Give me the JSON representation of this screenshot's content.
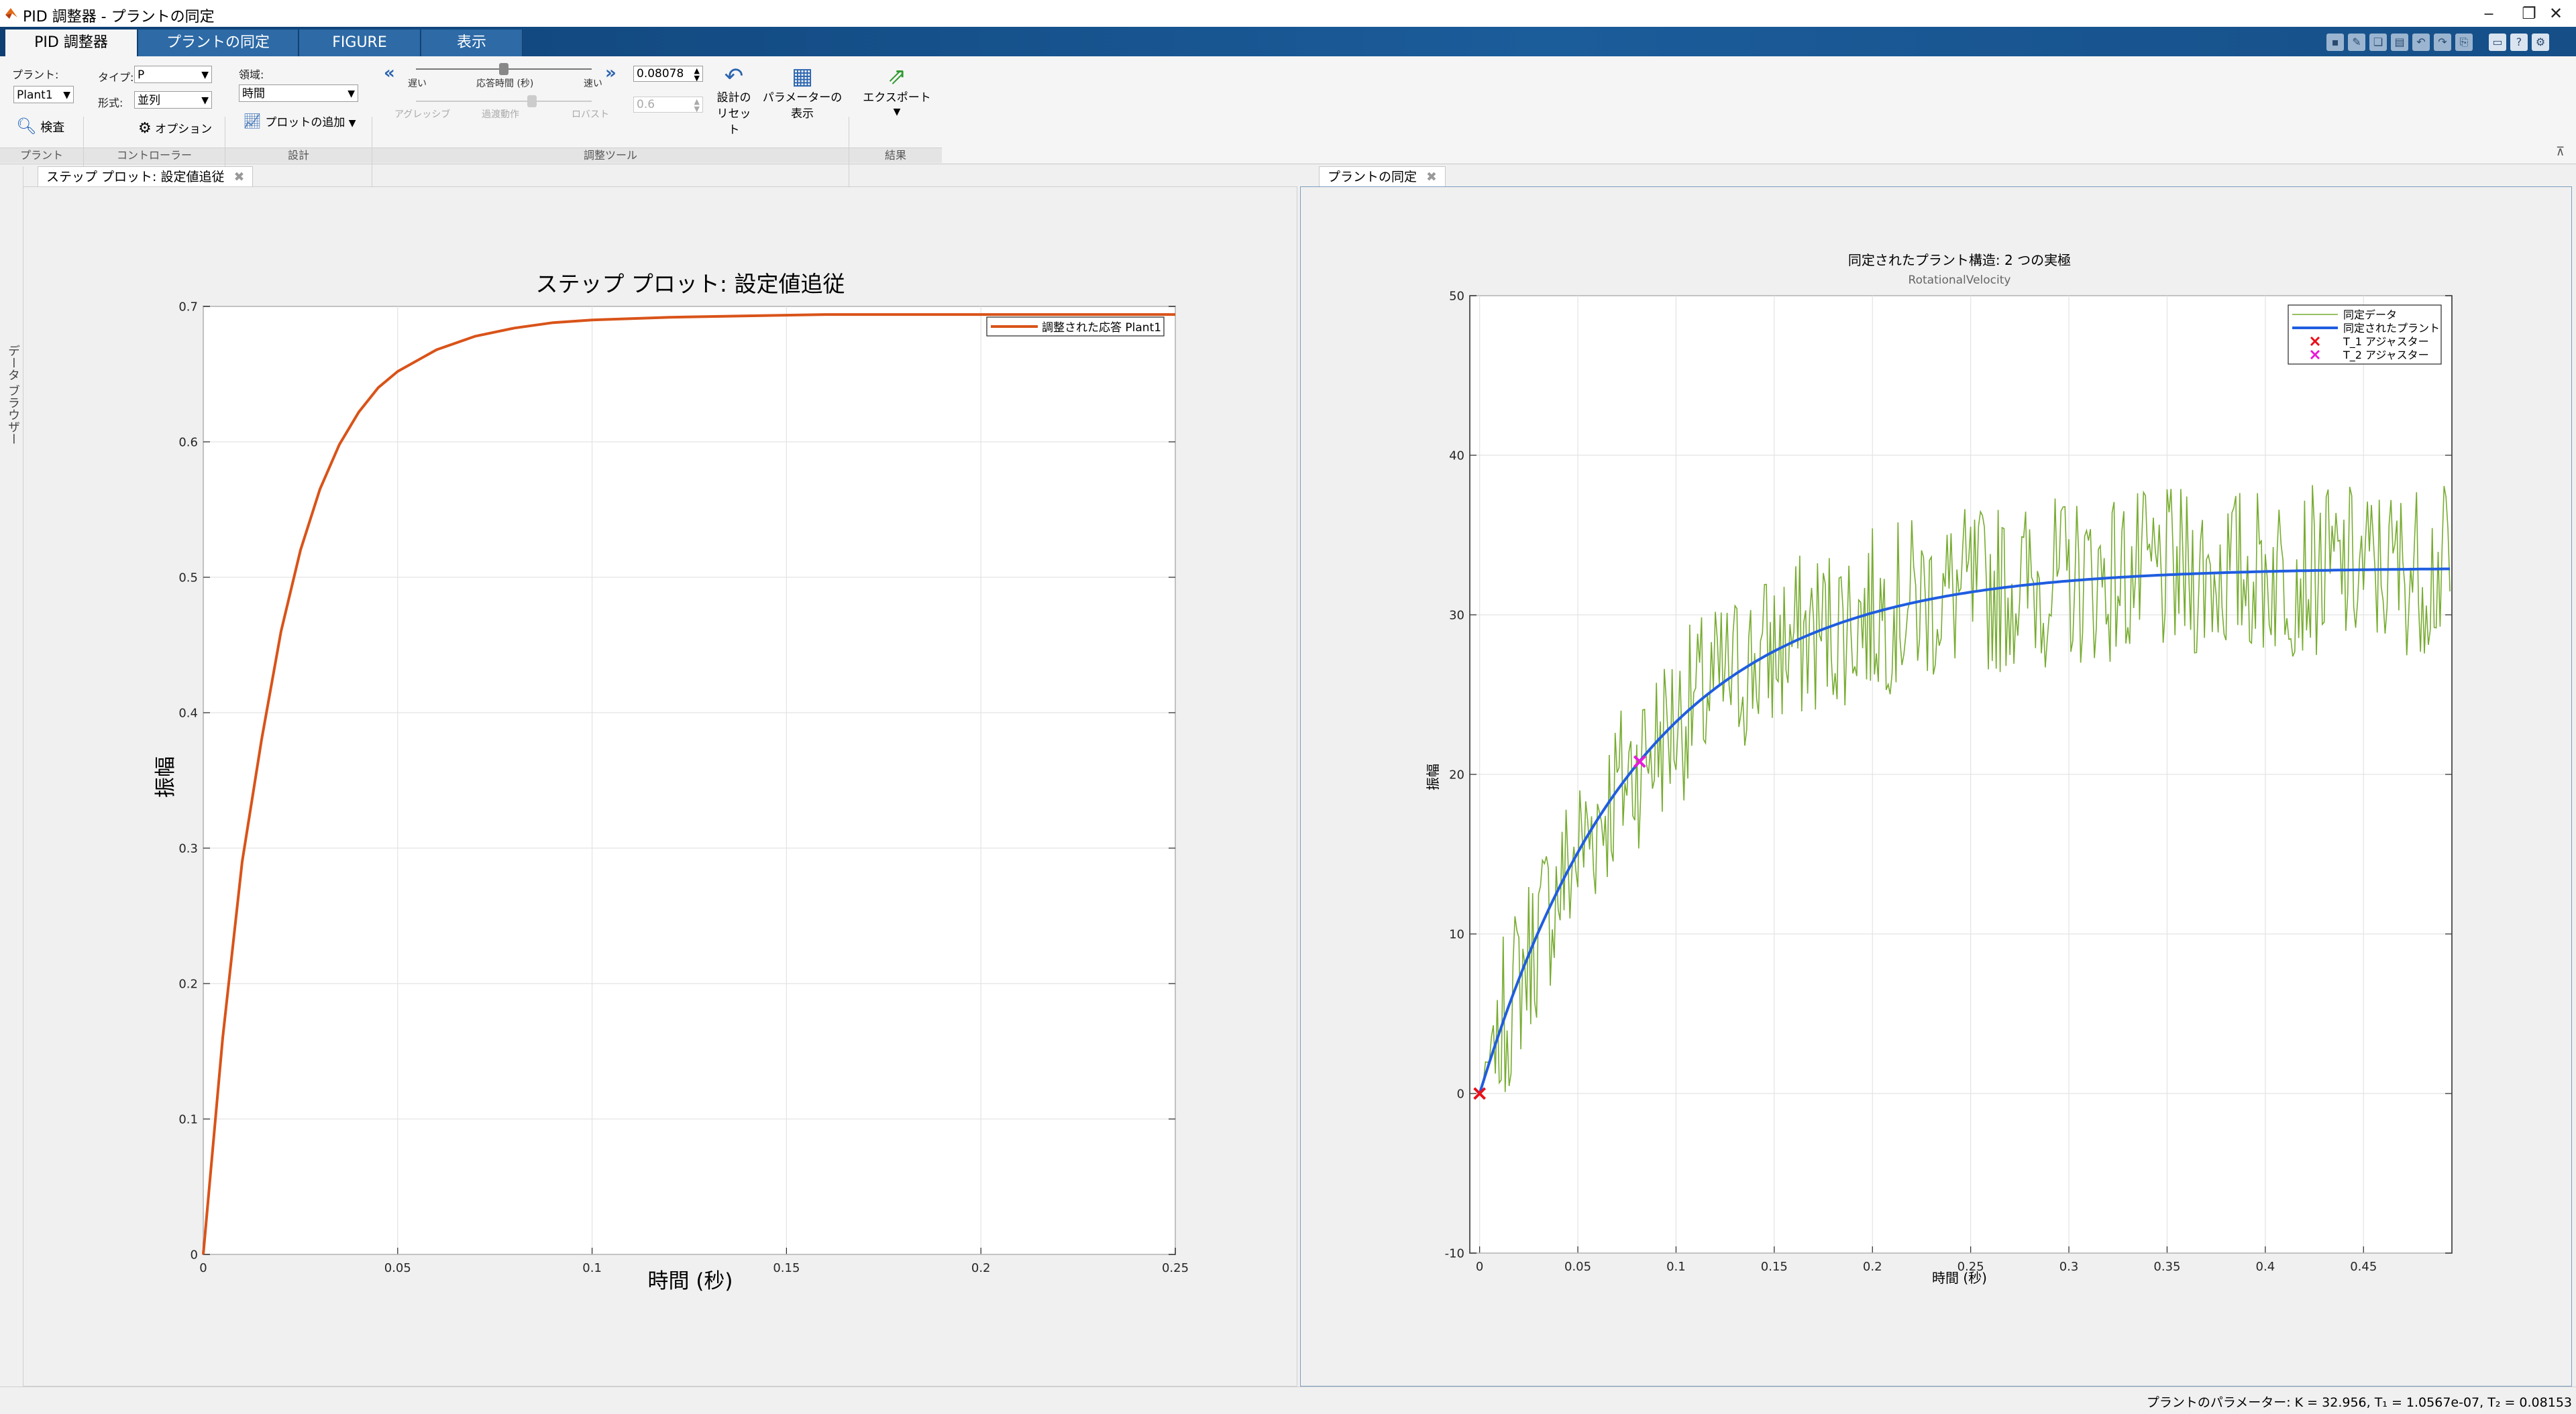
{
  "window": {
    "title": "PID 調整器 - プラントの同定",
    "buttons": [
      "‒",
      "❐",
      "✕"
    ]
  },
  "ribbon_tabs": [
    {
      "label": "PID 調整器",
      "active": true
    },
    {
      "label": "プラントの同定",
      "active": false
    },
    {
      "label": "FIGURE",
      "active": false
    },
    {
      "label": "表示",
      "active": false
    }
  ],
  "ribbon": {
    "plant": {
      "label": "プラント:",
      "value": "Plant1",
      "inspect": "検査",
      "section": "プラント"
    },
    "controller": {
      "type_label": "タイプ:",
      "type_value": "P",
      "form_label": "形式:",
      "form_value": "並列",
      "options": "オプション",
      "section": "コントローラー"
    },
    "design": {
      "domain_label": "領域:",
      "domain_value": "時間",
      "add_plot": "プロットの追加",
      "section": "設計"
    },
    "tuning": {
      "slow": "遅い",
      "response_time": "応答時間 (秒)",
      "fast": "速い",
      "response_value": "0.08078",
      "aggressive": "アグレッシブ",
      "transient": "過渡動作",
      "robust": "ロバスト",
      "transient_value": "0.6",
      "reset_line1": "設計の",
      "reset_line2": "リセット",
      "params_line1": "パラメーターの",
      "params_line2": "表示",
      "section": "調整ツール"
    },
    "results": {
      "export": "エクスポート",
      "section": "結果"
    }
  },
  "side_browser": "データ ブラウザー",
  "doc_tabs": {
    "left": "ステップ プロット: 設定値追従",
    "right": "プラントの同定"
  },
  "status": {
    "text": "プラントのパラメーター: K = 32.956, T₁ = 1.0567e-07, T₂ = 0.08153"
  },
  "chart_data": [
    {
      "type": "line",
      "title": "ステップ プロット: 設定値追従",
      "xlabel": "時間 (秒)",
      "ylabel": "振幅",
      "xlim": [
        0,
        0.25
      ],
      "ylim": [
        0,
        0.7
      ],
      "xticks": [
        "0",
        "0.05",
        "0.1",
        "0.15",
        "0.2",
        "0.25"
      ],
      "yticks": [
        "0",
        "0.1",
        "0.2",
        "0.3",
        "0.4",
        "0.5",
        "0.6",
        "0.7"
      ],
      "grid": true,
      "legend_position": "top-right",
      "series": [
        {
          "name": "調整された応答 Plant1",
          "color": "#d95319",
          "x": [
            0,
            0.005,
            0.01,
            0.015,
            0.02,
            0.025,
            0.03,
            0.035,
            0.04,
            0.045,
            0.05,
            0.06,
            0.07,
            0.08,
            0.09,
            0.1,
            0.12,
            0.14,
            0.16,
            0.18,
            0.2,
            0.25
          ],
          "y": [
            0,
            0.16,
            0.29,
            0.38,
            0.46,
            0.52,
            0.565,
            0.598,
            0.622,
            0.64,
            0.652,
            0.668,
            0.678,
            0.684,
            0.688,
            0.69,
            0.692,
            0.693,
            0.694,
            0.694,
            0.694,
            0.694
          ]
        }
      ]
    },
    {
      "type": "line",
      "title": "同定されたプラント構造: 2 つの実極",
      "subtitle": "RotationalVelocity",
      "xlabel": "時間 (秒)",
      "ylabel": "振幅",
      "xlim": [
        -0.005,
        0.495
      ],
      "ylim": [
        -10,
        50
      ],
      "xticks": [
        "0",
        "0.05",
        "0.1",
        "0.15",
        "0.2",
        "0.25",
        "0.3",
        "0.35",
        "0.4",
        "0.45"
      ],
      "yticks": [
        "-10",
        "0",
        "10",
        "20",
        "30",
        "40",
        "50"
      ],
      "grid": true,
      "legend_position": "top-right",
      "series": [
        {
          "name": "同定データ",
          "color": "#77ac30",
          "noisy": true,
          "K": 32.956,
          "T2": 0.08153,
          "noise_amplitude": 6
        },
        {
          "name": "同定されたプラント",
          "color": "#1f5de0",
          "K": 32.956,
          "T2": 0.08153
        }
      ],
      "markers": [
        {
          "name": "T_1 アジャスター",
          "color": "#e8101a",
          "x": 0,
          "y": 0
        },
        {
          "name": "T_2 アジャスター",
          "color": "#e81ad8",
          "x": 0.0815,
          "y": 20.8
        }
      ]
    }
  ]
}
